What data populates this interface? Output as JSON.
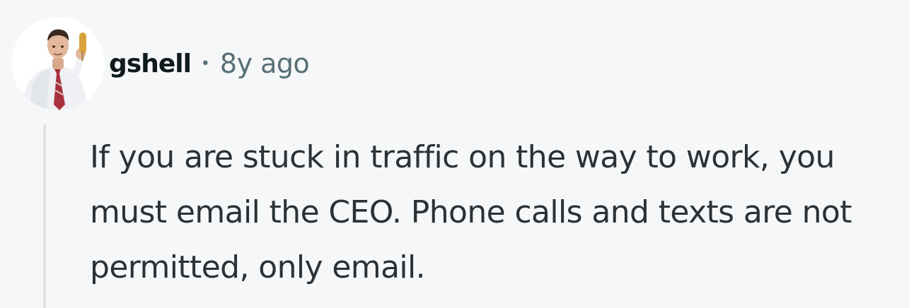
{
  "comment": {
    "author": {
      "username": "gshell",
      "avatar": "avatar-photo"
    },
    "separator": "•",
    "timestamp": "8y ago",
    "body": "If you are stuck in traffic on the way to work, you must email the CEO. Phone calls and texts are not permitted, only email."
  }
}
